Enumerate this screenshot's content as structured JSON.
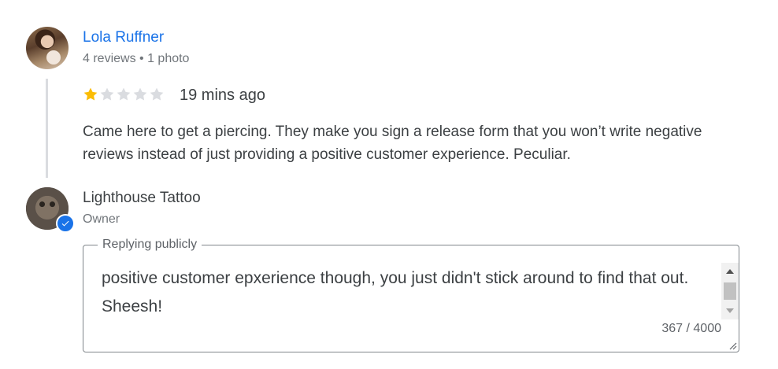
{
  "review": {
    "reviewer_name": "Lola Ruffner",
    "reviewer_meta": "4 reviews • 1 photo",
    "rating": 1,
    "rating_max": 5,
    "time": "19 mins ago",
    "text": "Came here to get a piercing. They make you sign a release form that you won’t write negative reviews instead of just providing a positive customer experience. Peculiar."
  },
  "owner": {
    "name": "Lighthouse Tattoo",
    "role": "Owner"
  },
  "reply": {
    "legend": "Replying publicly",
    "text": "positive customer epxerience though, you just didn't stick around to find that out.  Sheesh!",
    "counter": "367 / 4000"
  },
  "colors": {
    "link_blue": "#1a73e8",
    "star_filled": "#fbbc04",
    "star_empty": "#dadce0"
  },
  "icons": {
    "star": "star-icon",
    "verified": "verified-check-icon",
    "scroll_up": "triangle-up-icon",
    "scroll_down": "triangle-down-icon",
    "resize": "resize-grip-icon"
  }
}
